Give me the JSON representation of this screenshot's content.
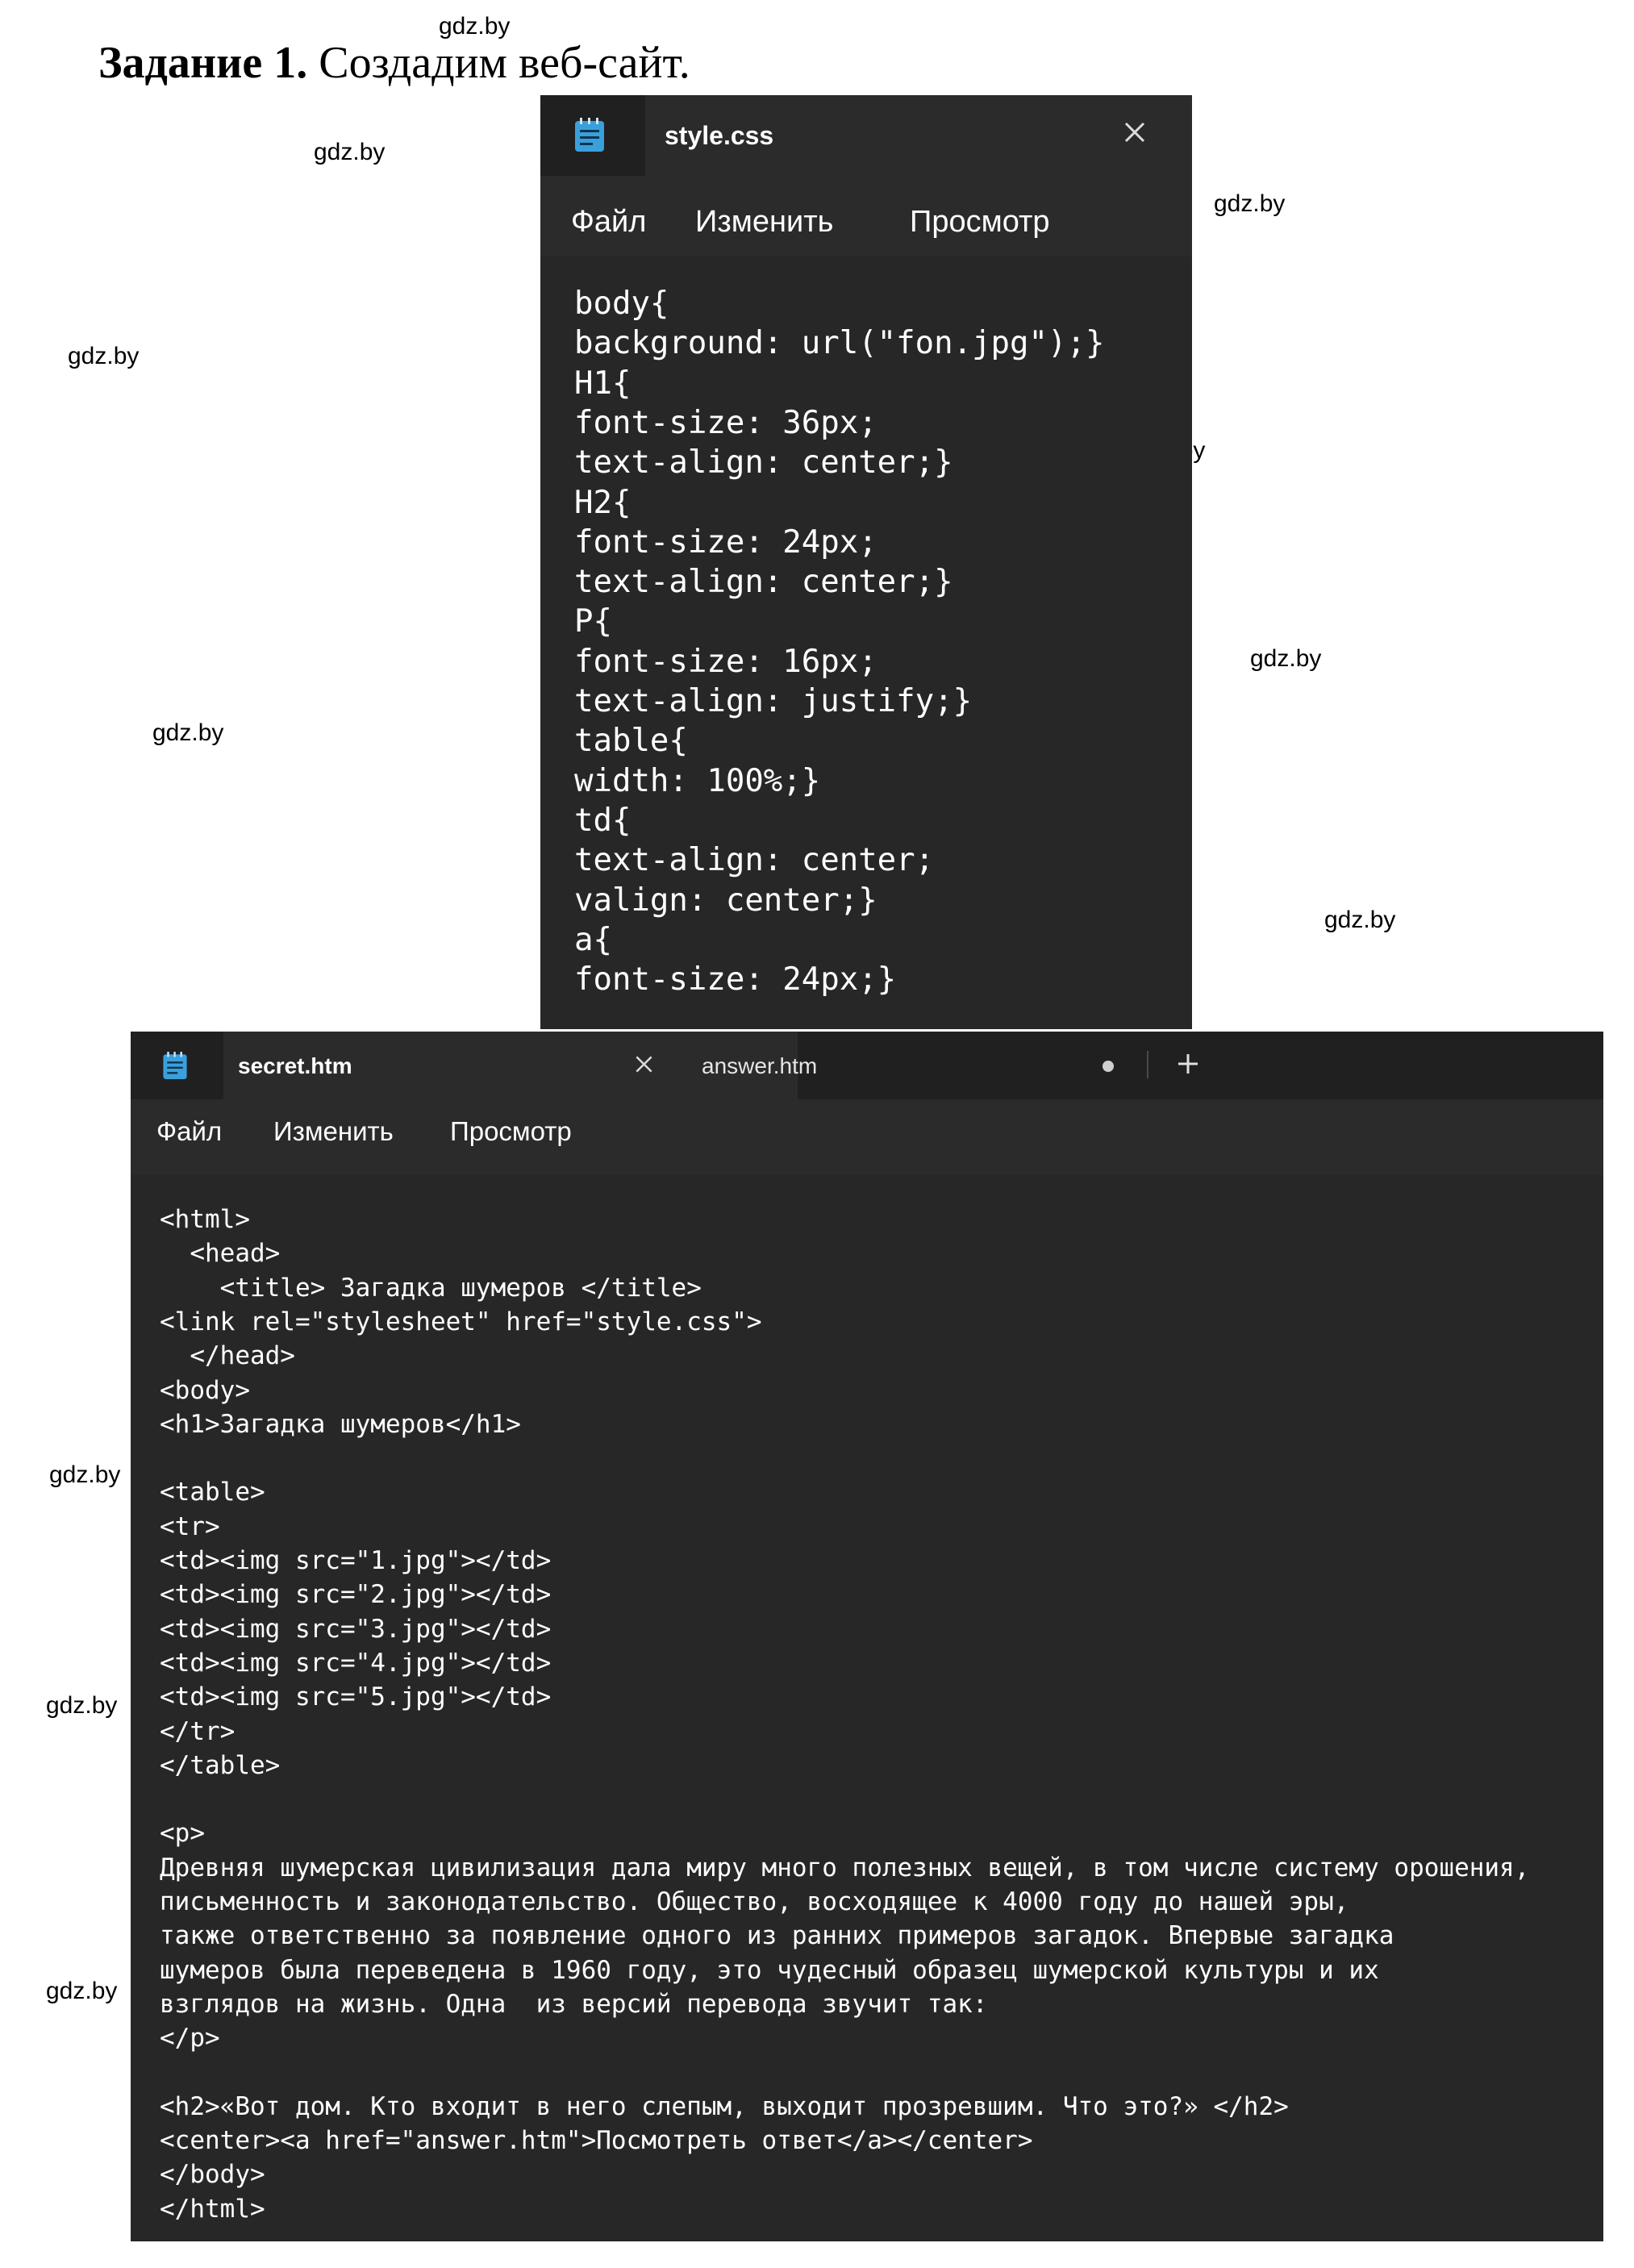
{
  "heading": {
    "bold": "Задание 1.",
    "rest": " Создадим веб-сайт."
  },
  "watermark": "gdz.by",
  "style_window": {
    "tab_title": "style.css",
    "menu": [
      "Файл",
      "Изменить",
      "Просмотр"
    ],
    "lines": [
      "body{",
      "background: url(\"fon.jpg\");}",
      "H1{",
      "font-size: 36px;",
      "text-align: center;}",
      "H2{",
      "font-size: 24px;",
      "text-align: center;}",
      "P{",
      "font-size: 16px;",
      "text-align: justify;}",
      "table{",
      "width: 100%;}",
      "td{",
      "text-align: center;",
      "valign: center;}",
      "a{",
      "font-size: 24px;}"
    ]
  },
  "html_window": {
    "tab_title": "secret.htm",
    "tab2_title": "answer.htm",
    "menu": [
      "Файл",
      "Изменить",
      "Просмотр"
    ],
    "lines": [
      "<html>",
      "  <head>",
      "    <title> Загадка шумеров </title>",
      "<link rel=\"stylesheet\" href=\"style.css\">",
      "  </head>",
      "<body>",
      "<h1>Загадка шумеров</h1>",
      "",
      "<table>",
      "<tr>",
      "<td><img src=\"1.jpg\"></td>",
      "<td><img src=\"2.jpg\"></td>",
      "<td><img src=\"3.jpg\"></td>",
      "<td><img src=\"4.jpg\"></td>",
      "<td><img src=\"5.jpg\"></td>",
      "</tr>",
      "</table>",
      "",
      "<p>",
      "Древняя шумерская цивилизация дала миру много полезных вещей, в том числе систему орошения,",
      "письменность и законодательство. Общество, восходящее к 4000 году до нашей эры,",
      "также ответственно за появление одного из ранних примеров загадок. Впервые загадка",
      "шумеров была переведена в 1960 году, это чудесный образец шумерской культуры и их",
      "взглядов на жизнь. Одна  из версий перевода звучит так:",
      "</p>",
      "",
      "<h2>«Вот дом. Кто входит в него слепым, выходит прозревшим. Что это?» </h2>",
      "<center><a href=\"answer.htm\">Посмотреть ответ</a></center>",
      "</body>",
      "</html>"
    ]
  }
}
